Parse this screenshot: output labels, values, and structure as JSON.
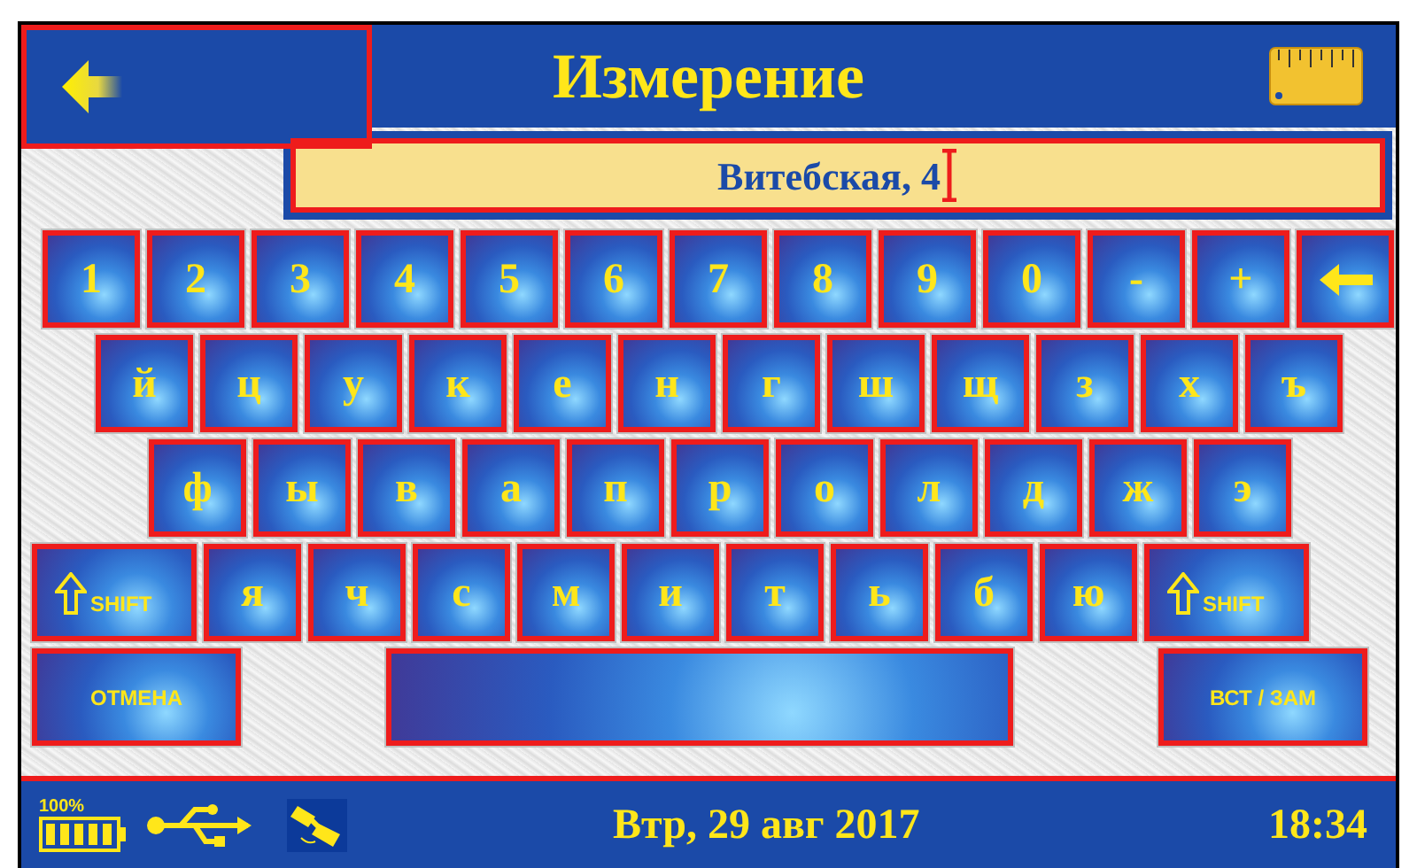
{
  "header": {
    "title": "Измерение"
  },
  "input": {
    "value": "Витебская, 4"
  },
  "keyboard": {
    "rows": [
      {
        "keys": [
          {
            "kind": "char",
            "label": "1"
          },
          {
            "kind": "char",
            "label": "2"
          },
          {
            "kind": "char",
            "label": "3"
          },
          {
            "kind": "char",
            "label": "4"
          },
          {
            "kind": "char",
            "label": "5"
          },
          {
            "kind": "char",
            "label": "6"
          },
          {
            "kind": "char",
            "label": "7"
          },
          {
            "kind": "char",
            "label": "8"
          },
          {
            "kind": "char",
            "label": "9"
          },
          {
            "kind": "char",
            "label": "0"
          },
          {
            "kind": "char",
            "label": "-"
          },
          {
            "kind": "char",
            "label": "+"
          },
          {
            "kind": "backspace"
          }
        ]
      },
      {
        "keys": [
          {
            "kind": "char",
            "label": "й"
          },
          {
            "kind": "char",
            "label": "ц"
          },
          {
            "kind": "char",
            "label": "у"
          },
          {
            "kind": "char",
            "label": "к"
          },
          {
            "kind": "char",
            "label": "е"
          },
          {
            "kind": "char",
            "label": "н"
          },
          {
            "kind": "char",
            "label": "г"
          },
          {
            "kind": "char",
            "label": "ш"
          },
          {
            "kind": "char",
            "label": "щ"
          },
          {
            "kind": "char",
            "label": "з"
          },
          {
            "kind": "char",
            "label": "х"
          },
          {
            "kind": "char",
            "label": "ъ"
          }
        ]
      },
      {
        "keys": [
          {
            "kind": "char",
            "label": "ф"
          },
          {
            "kind": "char",
            "label": "ы"
          },
          {
            "kind": "char",
            "label": "в"
          },
          {
            "kind": "char",
            "label": "а"
          },
          {
            "kind": "char",
            "label": "п"
          },
          {
            "kind": "char",
            "label": "р"
          },
          {
            "kind": "char",
            "label": "о"
          },
          {
            "kind": "char",
            "label": "л"
          },
          {
            "kind": "char",
            "label": "д"
          },
          {
            "kind": "char",
            "label": "ж"
          },
          {
            "kind": "char",
            "label": "э"
          }
        ]
      },
      {
        "keys": [
          {
            "kind": "shift",
            "label": "SHIFT"
          },
          {
            "kind": "char",
            "label": "я"
          },
          {
            "kind": "char",
            "label": "ч"
          },
          {
            "kind": "char",
            "label": "с"
          },
          {
            "kind": "char",
            "label": "м"
          },
          {
            "kind": "char",
            "label": "и"
          },
          {
            "kind": "char",
            "label": "т"
          },
          {
            "kind": "char",
            "label": "ь"
          },
          {
            "kind": "char",
            "label": "б"
          },
          {
            "kind": "char",
            "label": "ю"
          },
          {
            "kind": "shift",
            "label": "SHIFT"
          }
        ]
      },
      {
        "keys": [
          {
            "kind": "action",
            "label": "ОТМЕНА"
          },
          {
            "kind": "space"
          },
          {
            "kind": "action",
            "label": "ВСТ / ЗАМ"
          }
        ]
      }
    ]
  },
  "status_bar": {
    "battery": "100%",
    "date": "Втр, 29 авг 2017",
    "time": "18:34"
  }
}
